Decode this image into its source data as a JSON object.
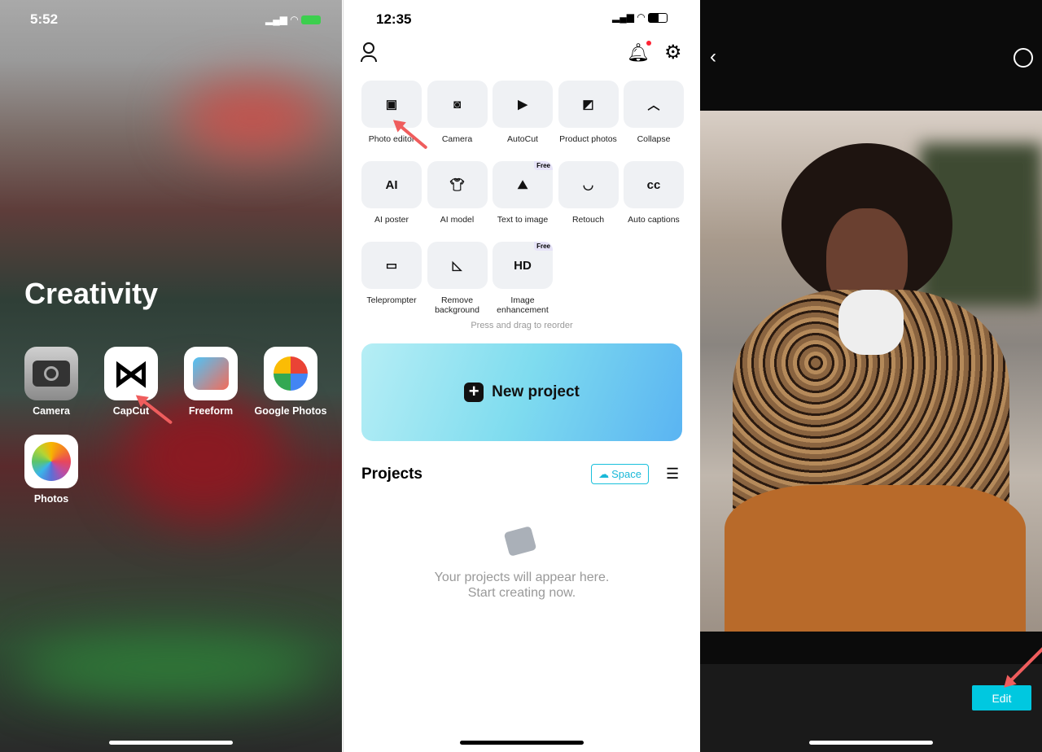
{
  "home_screen": {
    "status_time": "5:52",
    "folder_title": "Creativity",
    "apps": [
      {
        "label": "Camera",
        "icon": "camera-icon"
      },
      {
        "label": "CapCut",
        "icon": "capcut-logo"
      },
      {
        "label": "Freeform",
        "icon": "freeform-icon"
      },
      {
        "label": "Google Photos",
        "icon": "google-photos-icon"
      },
      {
        "label": "Photos",
        "icon": "photos-icon"
      }
    ]
  },
  "capcut_home": {
    "status_time": "12:35",
    "tools": [
      {
        "label": "Photo editor",
        "icon": "photo-editor-icon"
      },
      {
        "label": "Camera",
        "icon": "camera-icon"
      },
      {
        "label": "AutoCut",
        "icon": "autocut-icon"
      },
      {
        "label": "Product photos",
        "icon": "product-photos-icon"
      },
      {
        "label": "Collapse",
        "icon": "chevron-up-icon"
      },
      {
        "label": "AI poster",
        "icon": "ai-poster-icon"
      },
      {
        "label": "AI model",
        "icon": "ai-model-icon"
      },
      {
        "label": "Text to image",
        "icon": "text-to-image-icon",
        "badge": "Free"
      },
      {
        "label": "Retouch",
        "icon": "retouch-icon"
      },
      {
        "label": "Auto captions",
        "icon": "captions-icon"
      },
      {
        "label": "Teleprompter",
        "icon": "teleprompter-icon"
      },
      {
        "label": "Remove background",
        "icon": "remove-bg-icon"
      },
      {
        "label": "Image enhancement",
        "icon": "hd-icon",
        "badge": "Free"
      }
    ],
    "reorder_hint": "Press and drag to reorder",
    "new_project": "New project",
    "projects_title": "Projects",
    "space_label": "Space",
    "empty_line1": "Your projects will appear here.",
    "empty_line2": "Start creating now.",
    "accent": "#00c4e0"
  },
  "photo_preview": {
    "edit_label": "Edit",
    "accent": "#00c8e0"
  }
}
